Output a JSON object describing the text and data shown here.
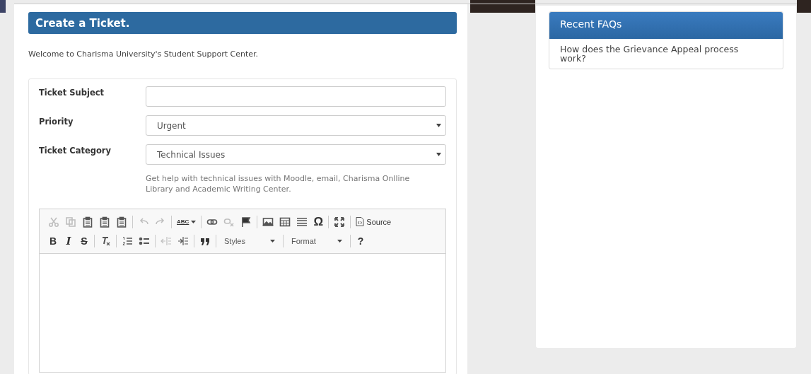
{
  "main": {
    "title": "Create a Ticket.",
    "welcome": "Welcome to Charisma University's Student Support Center."
  },
  "form": {
    "fields": [
      {
        "kind": "text",
        "label": "Ticket Subject"
      },
      {
        "kind": "select",
        "label": "Priority",
        "value": "Urgent"
      },
      {
        "kind": "select",
        "label": "Ticket Category",
        "value": "Technical Issues"
      }
    ],
    "help": "Get help with technical issues with Moodle, email, Charisma Onlline Library and Academic Writing Center."
  },
  "editor": {
    "toolbar_rows": [
      [
        [
          {
            "kind": "icon",
            "disabled": true
          },
          {
            "kind": "icon",
            "disabled": true
          },
          {
            "kind": "icon",
            "disabled": false
          },
          {
            "kind": "icon",
            "disabled": false
          },
          {
            "kind": "icon",
            "disabled": false
          }
        ],
        [
          {
            "kind": "icon",
            "disabled": true
          },
          {
            "kind": "icon",
            "disabled": true
          }
        ],
        [
          {
            "kind": "spell",
            "label": "ABC",
            "disabled": false
          }
        ],
        [
          {
            "kind": "icon",
            "disabled": false
          },
          {
            "kind": "icon",
            "disabled": true
          },
          {
            "kind": "icon",
            "disabled": false
          }
        ],
        [
          {
            "kind": "icon",
            "disabled": false
          },
          {
            "kind": "icon",
            "disabled": false
          },
          {
            "kind": "icon",
            "disabled": false
          },
          {
            "kind": "glyph",
            "label": "Ω",
            "disabled": false
          }
        ],
        [
          {
            "kind": "icon",
            "disabled": false
          }
        ],
        [
          {
            "kind": "button",
            "label": "Source",
            "disabled": false
          }
        ]
      ],
      [
        [
          {
            "kind": "glyph",
            "label": "B",
            "disabled": false
          },
          {
            "kind": "glyph",
            "label": "I",
            "disabled": false
          },
          {
            "kind": "glyph",
            "label": "S",
            "disabled": false
          }
        ],
        [
          {
            "kind": "icon",
            "disabled": false
          }
        ],
        [
          {
            "kind": "icon",
            "disabled": false
          },
          {
            "kind": "icon",
            "disabled": false
          }
        ],
        [
          {
            "kind": "icon",
            "disabled": true
          },
          {
            "kind": "icon",
            "disabled": false
          }
        ],
        [
          {
            "kind": "icon",
            "disabled": false
          }
        ],
        [
          {
            "kind": "combo",
            "label": "Styles"
          }
        ],
        [
          {
            "kind": "combo",
            "label": "Format"
          }
        ],
        [
          {
            "kind": "glyph",
            "label": "?",
            "disabled": false
          }
        ]
      ]
    ]
  },
  "faqs": {
    "title": "Recent FAQs",
    "items": [
      "How does the Grievance Appeal process work?"
    ]
  }
}
